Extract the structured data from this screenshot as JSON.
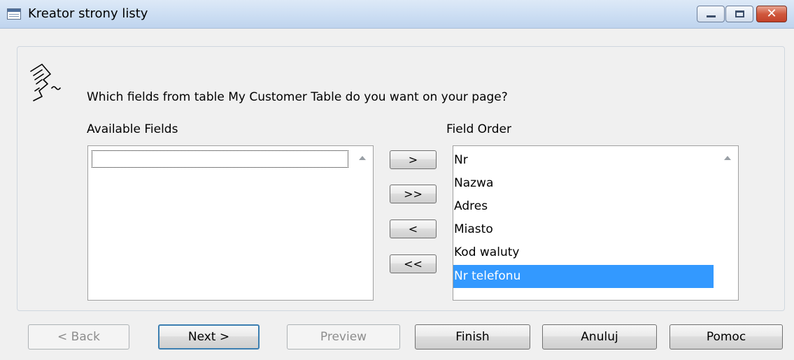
{
  "window": {
    "title": "Kreator strony listy",
    "controls": {
      "minimize": "minimize-icon",
      "maximize": "maximize-icon",
      "close": "close-icon"
    }
  },
  "wizard": {
    "question": "Which fields from table My Customer Table do you want on your page?",
    "available_label": "Available Fields",
    "order_label": "Field Order",
    "available_fields": [],
    "field_order": [
      "Nr",
      "Nazwa",
      "Adres",
      "Miasto",
      "Kod waluty",
      "Nr telefonu"
    ],
    "selected_field": "Nr telefonu",
    "move_buttons": {
      "add": ">",
      "add_all": ">>",
      "remove": "<",
      "remove_all": "<<"
    }
  },
  "buttons": {
    "back": "< Back",
    "next": "Next >",
    "preview": "Preview",
    "finish": "Finish",
    "cancel": "Anuluj",
    "help": "Pomoc"
  },
  "colors": {
    "selection": "#3399ff",
    "titlebar": "#cfe0f4",
    "close": "#c3422a"
  }
}
